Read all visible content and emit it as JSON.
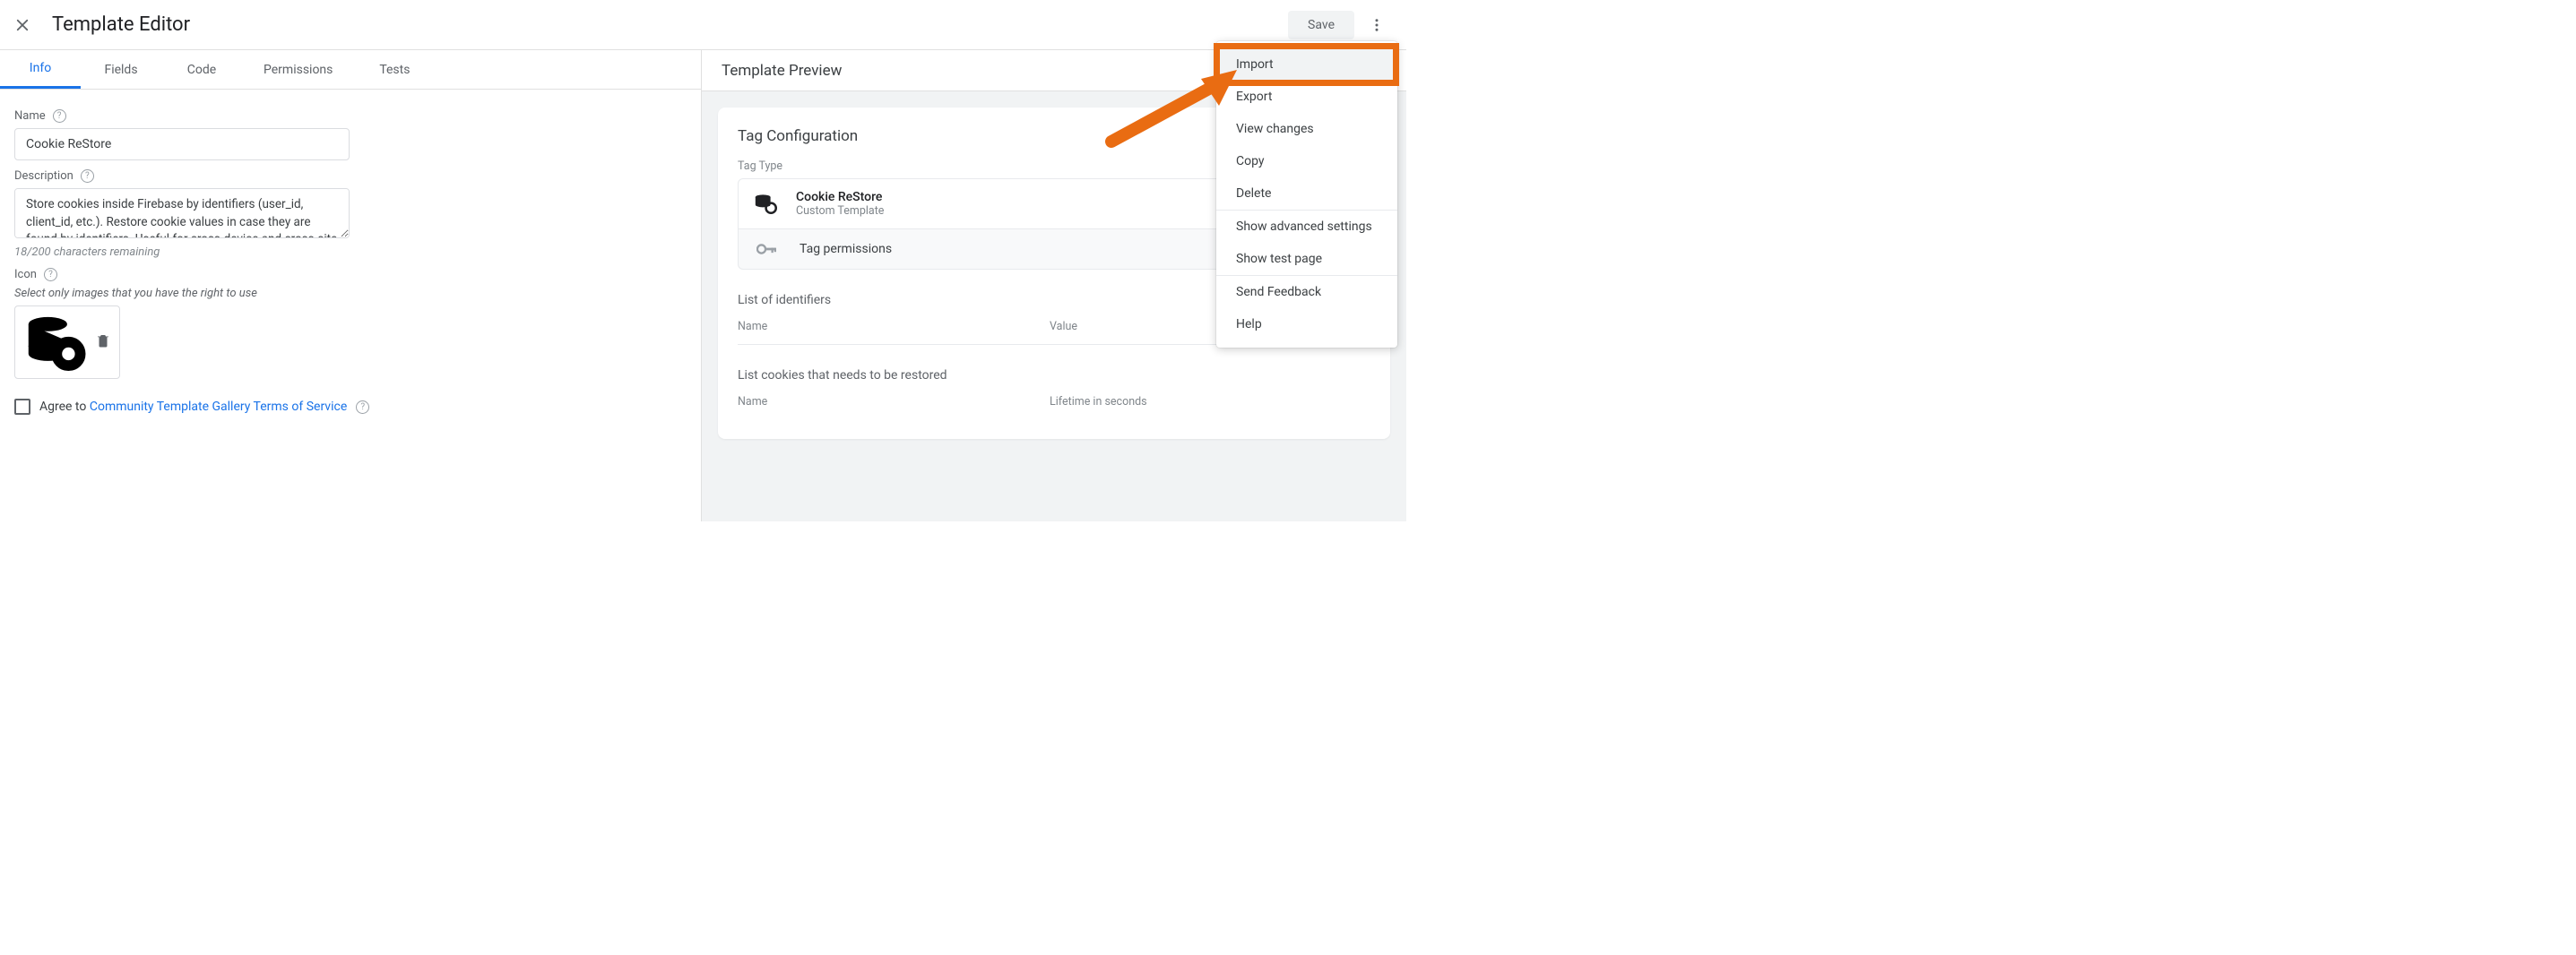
{
  "header": {
    "title": "Template Editor",
    "save_label": "Save"
  },
  "tabs": [
    {
      "label": "Info",
      "active": true
    },
    {
      "label": "Fields",
      "active": false
    },
    {
      "label": "Code",
      "active": false
    },
    {
      "label": "Permissions",
      "active": false
    },
    {
      "label": "Tests",
      "active": false
    }
  ],
  "form": {
    "name_label": "Name",
    "name_value": "Cookie ReStore",
    "desc_label": "Description",
    "desc_value": "Store cookies inside Firebase by identifiers (user_id, client_id, etc.). Restore cookie values in case they are found by identifiers. Useful for cross-device and cross-site",
    "desc_counter": "18/200 characters remaining",
    "icon_label": "Icon",
    "icon_hint": "Select only images that you have the right to use",
    "agree_prefix": "Agree to ",
    "agree_link": "Community Template Gallery Terms of Service"
  },
  "preview": {
    "heading": "Template Preview",
    "card_title": "Tag Configuration",
    "tag_type_label": "Tag Type",
    "template_name": "Cookie ReStore",
    "template_subtitle": "Custom Template",
    "permissions_label": "Tag permissions",
    "section_identifiers": "List of identifiers",
    "col_name": "Name",
    "col_value": "Value",
    "section_cookies": "List cookies that needs to be restored",
    "col_lifetime": "Lifetime in seconds"
  },
  "menu": {
    "items_a": [
      "Import",
      "Export",
      "View changes",
      "Copy",
      "Delete"
    ],
    "items_b": [
      "Show advanced settings",
      "Show test page"
    ],
    "items_c": [
      "Send Feedback",
      "Help"
    ]
  }
}
